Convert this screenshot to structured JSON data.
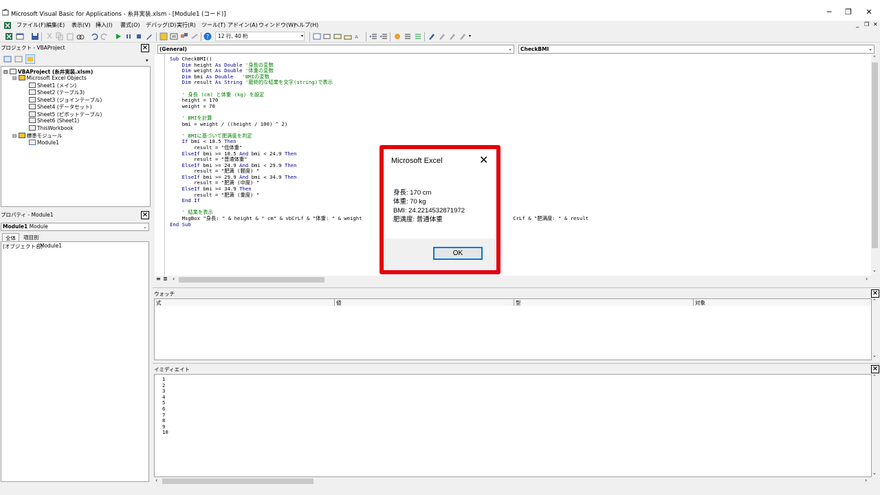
{
  "window": {
    "title": "Microsoft Visual Basic for Applications - 糸井実装.xlsm - [Module1 (コード)]",
    "min": "─",
    "max": "❐",
    "close": "✕"
  },
  "menu": [
    "ファイル(F)",
    "編集(E)",
    "表示(V)",
    "挿入(I)",
    "書式(O)",
    "デバッグ(D)",
    "実行(R)",
    "ツール(T)",
    "アドイン(A)",
    "ウィンドウ(W)",
    "ヘルプ(H)"
  ],
  "toolbar": {
    "position": "12 行, 40 桁"
  },
  "project": {
    "title": "プロジェクト - VBAProject",
    "tree": {
      "root": "VBAProject (糸井実装.xlsm)",
      "excel_objects": "Microsoft Excel Objects",
      "sheets": [
        "Sheet1 (メイン)",
        "Sheet2 (テーブル3)",
        "Sheet3 (ジョインテーブル)",
        "Sheet4 (データセット)",
        "Sheet5 (ピボットテーブル)",
        "Sheet6 (Sheet1)",
        "ThisWorkbook"
      ],
      "modules_folder": "標準モジュール",
      "module": "Module1"
    }
  },
  "properties": {
    "title": "プロパティ - Module1",
    "object_bold": "Module1",
    "object_type": "Module",
    "tab_all": "全体",
    "tab_category": "項目別",
    "prop_name": "(オブジェクト名)",
    "prop_value": "Module1"
  },
  "code": {
    "left_dropdown": "(General)",
    "right_dropdown": "CheckBMI"
  },
  "watch": {
    "title": "ウォッチ",
    "cols": [
      "式",
      "値",
      "型",
      "対象"
    ]
  },
  "immediate": {
    "title": "イミディエイト",
    "lines": "1\n2\n3\n4\n5\n6\n7\n8\n9\n10"
  },
  "msgbox": {
    "title": "Microsoft Excel",
    "message": "身長: 170 cm\n体重: 70 kg\nBMI: 24.2214532871972\n肥満度: 普通体重",
    "ok": "OK"
  }
}
